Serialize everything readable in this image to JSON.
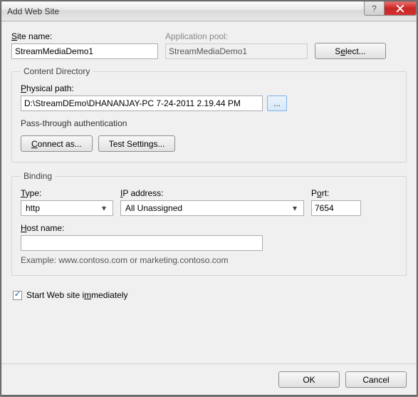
{
  "title": "Add Web Site",
  "labels": {
    "site_name": "Site name:",
    "app_pool": "Application pool:",
    "select_btn": "Select...",
    "content_dir": "Content Directory",
    "physical_path": "Physical path:",
    "browse": "...",
    "passthrough": "Pass-through authentication",
    "connect_as": "Connect as...",
    "test_settings": "Test Settings...",
    "binding": "Binding",
    "type": "Type:",
    "ip_address": "IP address:",
    "port": "Port:",
    "host_name": "Host name:",
    "example": "Example: www.contoso.com or marketing.contoso.com",
    "start_immediately": "Start Web site immediately",
    "ok": "OK",
    "cancel": "Cancel"
  },
  "values": {
    "site_name": "StreamMediaDemo1",
    "app_pool": "StreamMediaDemo1",
    "physical_path": "D:\\StreamDEmo\\DHANANJAY-PC 7-24-2011 2.19.44 PM",
    "type": "http",
    "ip_address": "All Unassigned",
    "port": "7654",
    "host_name": ""
  },
  "state": {
    "start_immediately_checked": true
  }
}
